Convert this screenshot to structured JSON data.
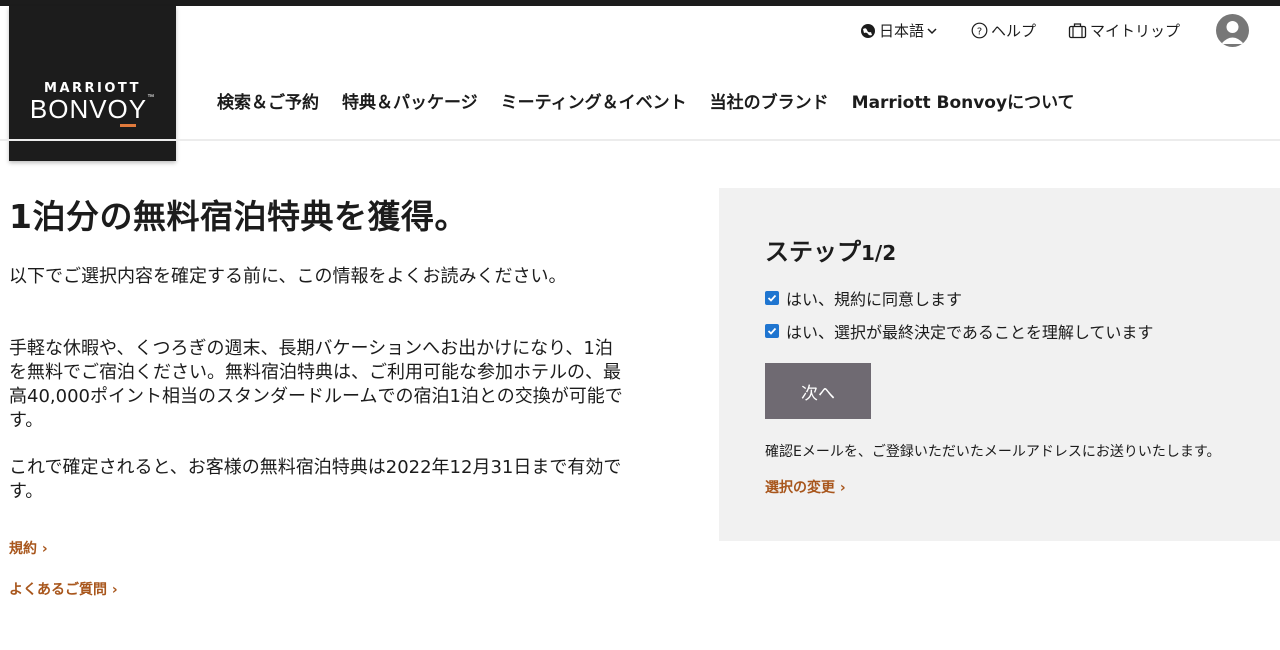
{
  "logo": {
    "line1": "MARRIOTT",
    "line2": "BONVOY",
    "tm": "™"
  },
  "utility": {
    "language": "日本語",
    "help": "ヘルプ",
    "my_trip": "マイトリップ"
  },
  "icons": {
    "language": "globe-icon",
    "help": "question-circle-icon",
    "trip": "suitcase-icon",
    "account": "user-avatar-icon"
  },
  "nav": {
    "items": [
      "検索＆ご予約",
      "特典＆パッケージ",
      "ミーティング＆イベント",
      "当社のブランド",
      "Marriott Bonvoyについて"
    ]
  },
  "main": {
    "title": "1泊分の無料宿泊特典を獲得。",
    "para1": "以下でご選択内容を確定する前に、この情報をよくお読みください。",
    "para2": "手軽な休暇や、くつろぎの週末、長期バケーションへお出かけになり、1泊を無料でご宿泊ください。無料宿泊特典は、ご利用可能な参加ホテルの、最高40,000ポイント相当のスタンダードルームでの宿泊1泊との交換が可能です。",
    "para3": "これで確定されると、お客様の無料宿泊特典は2022年12月31日まで有効です。",
    "terms_link": "規約 ›",
    "faq_link": "よくあるご質問 ›"
  },
  "panel": {
    "step_label": "ステップ",
    "step_count": "1/2",
    "check1": "はい、規約に同意します",
    "check2": "はい、選択が最終決定であることを理解しています",
    "next_button": "次へ",
    "email_note": "確認Eメールを、ご登録いただいたメールアドレスにお送りいたします。",
    "change_link": "選択の変更 ›"
  },
  "colors": {
    "brand_dark": "#1c1c1c",
    "accent_orange": "#e07a3c",
    "link_brown": "#a8561c",
    "button_gray": "#6f6a72",
    "panel_bg": "#f1f1f1",
    "checkbox_blue": "#1f75d0"
  }
}
